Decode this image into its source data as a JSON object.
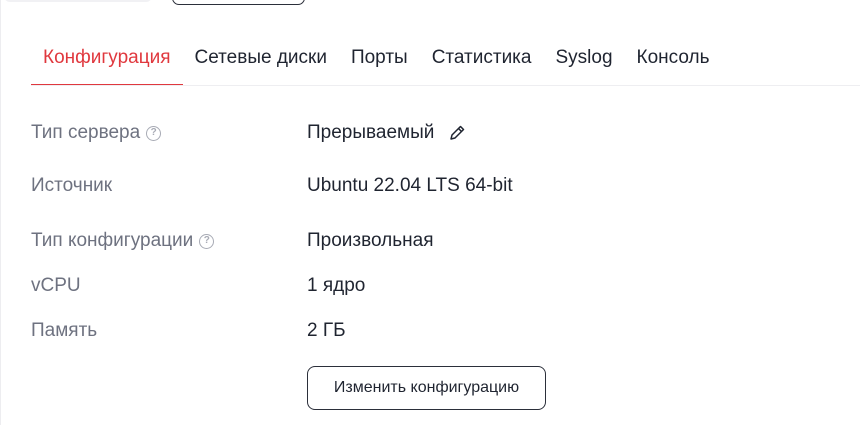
{
  "tabs": [
    {
      "label": "Конфигурация",
      "active": true
    },
    {
      "label": "Сетевые диски",
      "active": false
    },
    {
      "label": "Порты",
      "active": false
    },
    {
      "label": "Статистика",
      "active": false
    },
    {
      "label": "Syslog",
      "active": false
    },
    {
      "label": "Консоль",
      "active": false
    }
  ],
  "properties": {
    "server_type": {
      "label": "Тип сервера",
      "value": "Прерываемый",
      "help_icon": "question-circle-icon",
      "edit_icon": "pencil-icon"
    },
    "source": {
      "label": "Источник",
      "value": "Ubuntu 22.04 LTS 64-bit"
    },
    "config_type": {
      "label": "Тип конфигурации",
      "value": "Произвольная",
      "help_icon": "question-circle-icon"
    },
    "vcpu": {
      "label": "vCPU",
      "value": "1 ядро"
    },
    "memory": {
      "label": "Память",
      "value": "2 ГБ"
    }
  },
  "actions": {
    "change_config_label": "Изменить конфигурацию"
  },
  "colors": {
    "accent": "#e0383e",
    "text": "#1f2430",
    "muted": "#6e7280"
  }
}
